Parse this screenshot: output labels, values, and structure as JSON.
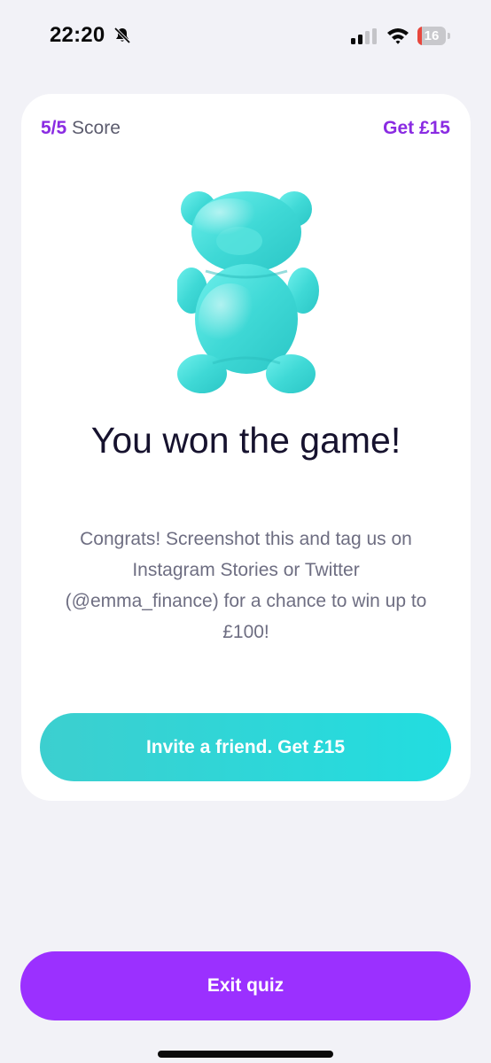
{
  "status_bar": {
    "time": "22:20",
    "battery_level": "16",
    "battery_fraction": 0.16,
    "icons": [
      "bell-slash-icon",
      "cellular-signal-icon",
      "wifi-icon",
      "battery-icon"
    ]
  },
  "card": {
    "score_value": "5/5",
    "score_label": "Score",
    "reward_link": "Get £15",
    "image": "gummy-bear-illustration",
    "headline": "You won the game!",
    "body": "Congrats! Screenshot this and tag us on Instagram Stories or Twitter (@emma_finance) for a chance to win up to £100!",
    "invite_button": "Invite a friend. Get £15"
  },
  "footer": {
    "exit_button": "Exit quiz"
  },
  "colors": {
    "accent_purple": "#8a2be2",
    "exit_button": "#9b30ff",
    "invite_button": "#22dde0",
    "background": "#f2f2f7"
  }
}
